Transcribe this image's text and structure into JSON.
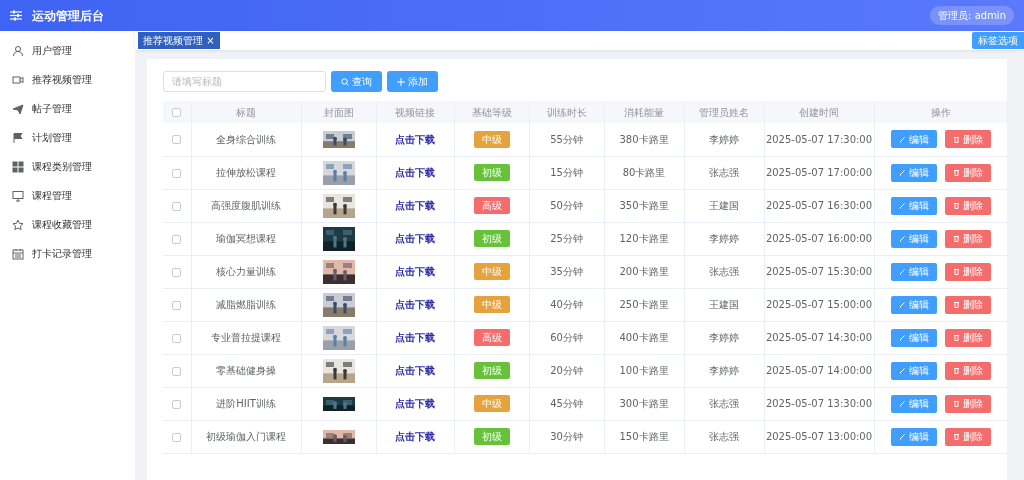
{
  "header": {
    "title": "运动管理后台",
    "user_menu": "管理员: admin"
  },
  "sidebar": {
    "items": [
      {
        "label": "用户管理",
        "selected": false
      },
      {
        "label": "推荐视频管理",
        "selected": false
      },
      {
        "label": "帖子管理",
        "selected": false
      },
      {
        "label": "计划管理",
        "selected": false
      },
      {
        "label": "课程类别管理",
        "selected": false
      },
      {
        "label": "课程管理",
        "selected": false
      },
      {
        "label": "课程收藏管理",
        "selected": false
      },
      {
        "label": "打卡记录管理",
        "selected": false
      }
    ]
  },
  "tabs": [
    {
      "label": "推荐视频管理",
      "close": "×",
      "selected": true
    }
  ],
  "tab_options": "标签选项",
  "search": {
    "placeholder": "请填写标题"
  },
  "toolbar_buttons": [
    {
      "label": "查询",
      "kind": "search"
    },
    {
      "label": "添加",
      "kind": "add"
    }
  ],
  "table": {
    "columns": [
      "标题",
      "封面图",
      "视频链接",
      "基础等级",
      "训练时长",
      "消耗能量",
      "管理员姓名",
      "创建时间",
      "操作"
    ],
    "header_checked": false,
    "rows": [
      {
        "checked": false,
        "title": "全身综合训练",
        "link": "点击下载",
        "level": {
          "text": "中级",
          "color": "#e6a23c"
        },
        "duration": "55分钟",
        "calories": "380卡路里",
        "admin": "李婷婷",
        "created": "2025-05-07 17:30:00",
        "actions": [
          "编辑",
          "删除"
        ]
      },
      {
        "checked": false,
        "title": "拉伸放松课程",
        "link": "点击下载",
        "level": {
          "text": "初级",
          "color": "#67c23a"
        },
        "duration": "15分钟",
        "calories": "80卡路里",
        "admin": "张志强",
        "created": "2025-05-07 17:00:00",
        "actions": [
          "编辑",
          "删除"
        ]
      },
      {
        "checked": false,
        "title": "高强度腹肌训练",
        "link": "点击下载",
        "level": {
          "text": "高级",
          "color": "#f56c6c"
        },
        "duration": "50分钟",
        "calories": "350卡路里",
        "admin": "王建国",
        "created": "2025-05-07 16:30:00",
        "actions": [
          "编辑",
          "删除"
        ]
      },
      {
        "checked": false,
        "title": "瑜伽冥想课程",
        "link": "点击下载",
        "level": {
          "text": "初级",
          "color": "#67c23a"
        },
        "duration": "25分钟",
        "calories": "120卡路里",
        "admin": "李婷婷",
        "created": "2025-05-07 16:00:00",
        "actions": [
          "编辑",
          "删除"
        ]
      },
      {
        "checked": false,
        "title": "核心力量训练",
        "link": "点击下载",
        "level": {
          "text": "中级",
          "color": "#e6a23c"
        },
        "duration": "35分钟",
        "calories": "200卡路里",
        "admin": "张志强",
        "created": "2025-05-07 15:30:00",
        "actions": [
          "编辑",
          "删除"
        ]
      },
      {
        "checked": false,
        "title": "减脂燃脂训练",
        "link": "点击下载",
        "level": {
          "text": "中级",
          "color": "#e6a23c"
        },
        "duration": "40分钟",
        "calories": "250卡路里",
        "admin": "王建国",
        "created": "2025-05-07 15:00:00",
        "actions": [
          "编辑",
          "删除"
        ]
      },
      {
        "checked": false,
        "title": "专业普拉提课程",
        "link": "点击下载",
        "level": {
          "text": "高级",
          "color": "#f56c6c"
        },
        "duration": "60分钟",
        "calories": "400卡路里",
        "admin": "李婷婷",
        "created": "2025-05-07 14:30:00",
        "actions": [
          "编辑",
          "删除"
        ]
      },
      {
        "checked": false,
        "title": "零基础健身操",
        "link": "点击下载",
        "level": {
          "text": "初级",
          "color": "#67c23a"
        },
        "duration": "20分钟",
        "calories": "100卡路里",
        "admin": "李婷婷",
        "created": "2025-05-07 14:00:00",
        "actions": [
          "编辑",
          "删除"
        ]
      },
      {
        "checked": false,
        "title": "进阶HIIT训练",
        "link": "点击下载",
        "level": {
          "text": "中级",
          "color": "#e6a23c"
        },
        "duration": "45分钟",
        "calories": "300卡路里",
        "admin": "张志强",
        "created": "2025-05-07 13:30:00",
        "actions": [
          "编辑",
          "删除"
        ]
      },
      {
        "checked": false,
        "title": "初级瑜伽入门课程",
        "link": "点击下载",
        "level": {
          "text": "初级",
          "color": "#67c23a"
        },
        "duration": "30分钟",
        "calories": "150卡路里",
        "admin": "张志强",
        "created": "2025-05-07 13:00:00",
        "actions": [
          "编辑",
          "删除"
        ]
      }
    ]
  }
}
